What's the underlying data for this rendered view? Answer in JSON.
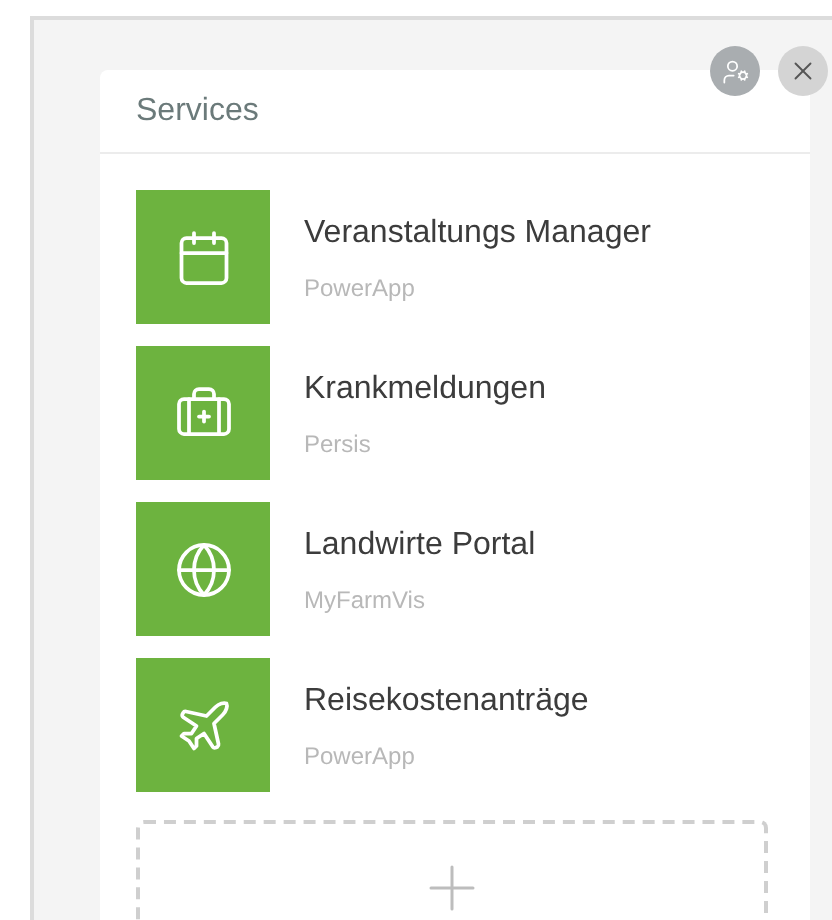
{
  "panel": {
    "title": "Services"
  },
  "services": [
    {
      "name": "Veranstaltungs Manager",
      "source": "PowerApp"
    },
    {
      "name": "Krankmeldungen",
      "source": "Persis"
    },
    {
      "name": "Landwirte Portal",
      "source": "MyFarmVis"
    },
    {
      "name": "Reisekostenanträge",
      "source": "PowerApp"
    }
  ]
}
